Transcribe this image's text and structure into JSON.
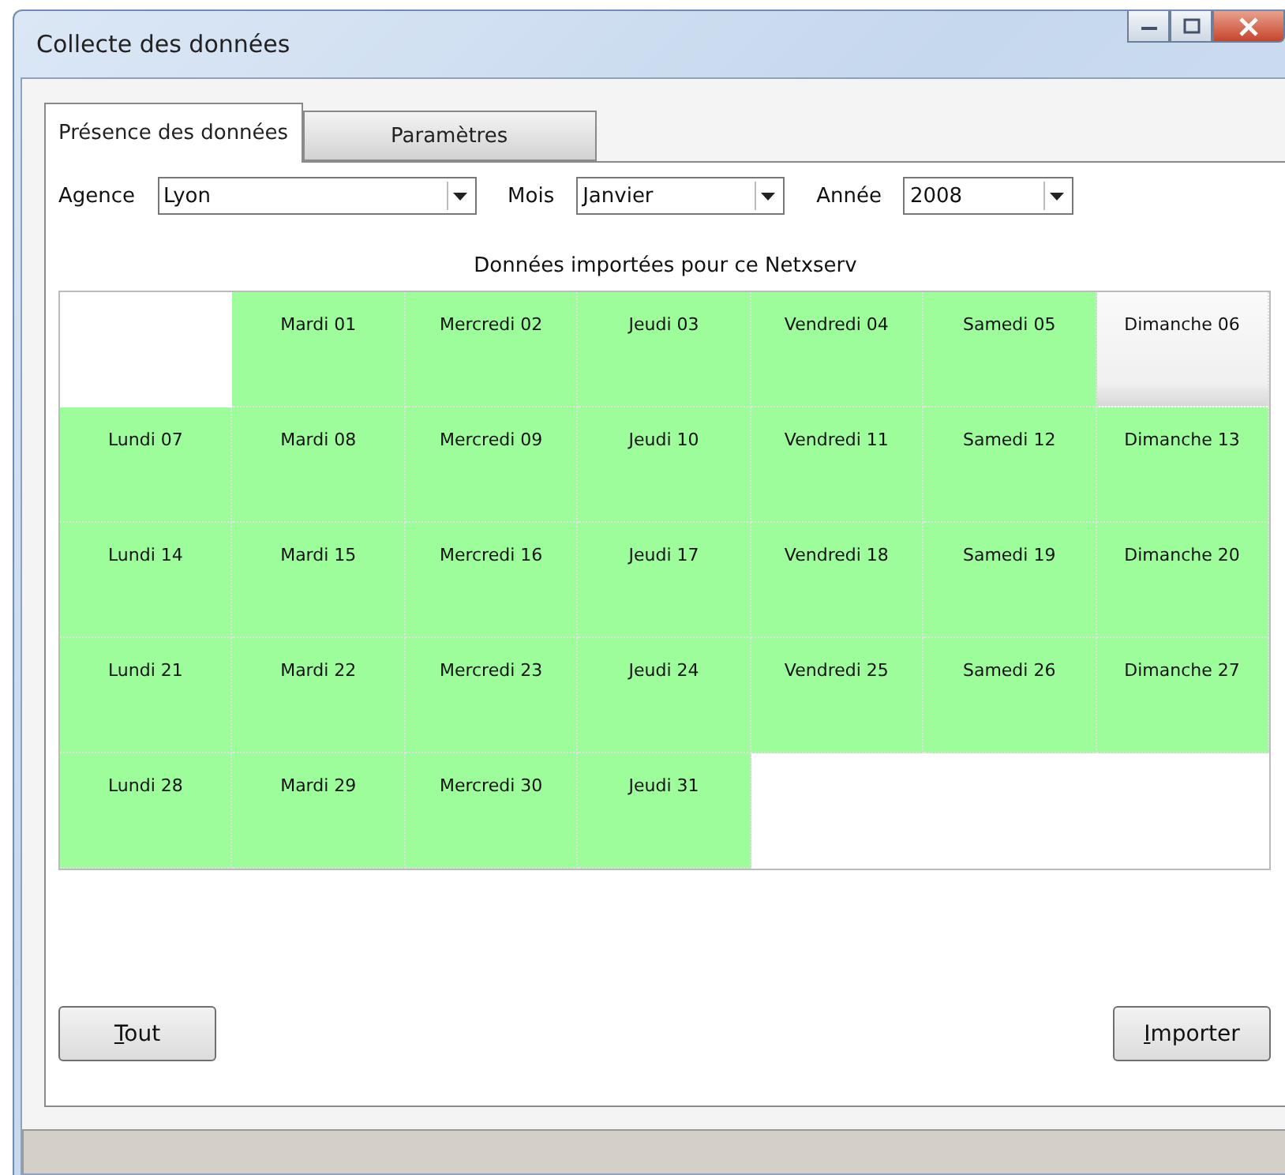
{
  "window": {
    "title": "Collecte des données"
  },
  "tabs": [
    {
      "label": "Présence des données",
      "selected": true
    },
    {
      "label": "Paramètres",
      "selected": false
    }
  ],
  "filters": [
    {
      "label": "Agence",
      "value": "Lyon"
    },
    {
      "label": "Mois",
      "value": "Janvier"
    },
    {
      "label": "Année",
      "value": "2008"
    }
  ],
  "calendar": {
    "title": "Données importées pour ce Netxserv",
    "weeks": [
      [
        {
          "kind": "empty"
        },
        {
          "kind": "day",
          "label": "Mardi 01",
          "imported": true
        },
        {
          "kind": "day",
          "label": "Mercredi 02",
          "imported": true
        },
        {
          "kind": "day",
          "label": "Jeudi 03",
          "imported": true
        },
        {
          "kind": "day",
          "label": "Vendredi 04",
          "imported": true
        },
        {
          "kind": "day",
          "label": "Samedi 05",
          "imported": true
        },
        {
          "kind": "day",
          "label": "Dimanche 06",
          "imported": false
        }
      ],
      [
        {
          "kind": "day",
          "label": "Lundi 07",
          "imported": true
        },
        {
          "kind": "day",
          "label": "Mardi 08",
          "imported": true
        },
        {
          "kind": "day",
          "label": "Mercredi 09",
          "imported": true
        },
        {
          "kind": "day",
          "label": "Jeudi 10",
          "imported": true
        },
        {
          "kind": "day",
          "label": "Vendredi 11",
          "imported": true
        },
        {
          "kind": "day",
          "label": "Samedi 12",
          "imported": true
        },
        {
          "kind": "day",
          "label": "Dimanche 13",
          "imported": true
        }
      ],
      [
        {
          "kind": "day",
          "label": "Lundi 14",
          "imported": true
        },
        {
          "kind": "day",
          "label": "Mardi 15",
          "imported": true
        },
        {
          "kind": "day",
          "label": "Mercredi 16",
          "imported": true
        },
        {
          "kind": "day",
          "label": "Jeudi 17",
          "imported": true
        },
        {
          "kind": "day",
          "label": "Vendredi 18",
          "imported": true
        },
        {
          "kind": "day",
          "label": "Samedi 19",
          "imported": true
        },
        {
          "kind": "day",
          "label": "Dimanche 20",
          "imported": true
        }
      ],
      [
        {
          "kind": "day",
          "label": "Lundi 21",
          "imported": true
        },
        {
          "kind": "day",
          "label": "Mardi 22",
          "imported": true
        },
        {
          "kind": "day",
          "label": "Mercredi 23",
          "imported": true
        },
        {
          "kind": "day",
          "label": "Jeudi 24",
          "imported": true
        },
        {
          "kind": "day",
          "label": "Vendredi 25",
          "imported": true
        },
        {
          "kind": "day",
          "label": "Samedi 26",
          "imported": true
        },
        {
          "kind": "day",
          "label": "Dimanche 27",
          "imported": true
        }
      ],
      [
        {
          "kind": "day",
          "label": "Lundi 28",
          "imported": true
        },
        {
          "kind": "day",
          "label": "Mardi 29",
          "imported": true
        },
        {
          "kind": "day",
          "label": "Mercredi 30",
          "imported": true
        },
        {
          "kind": "day",
          "label": "Jeudi 31",
          "imported": true
        },
        {
          "kind": "empty"
        },
        {
          "kind": "empty"
        },
        {
          "kind": "empty"
        }
      ]
    ]
  },
  "buttons": [
    "Tout",
    "Importer"
  ]
}
